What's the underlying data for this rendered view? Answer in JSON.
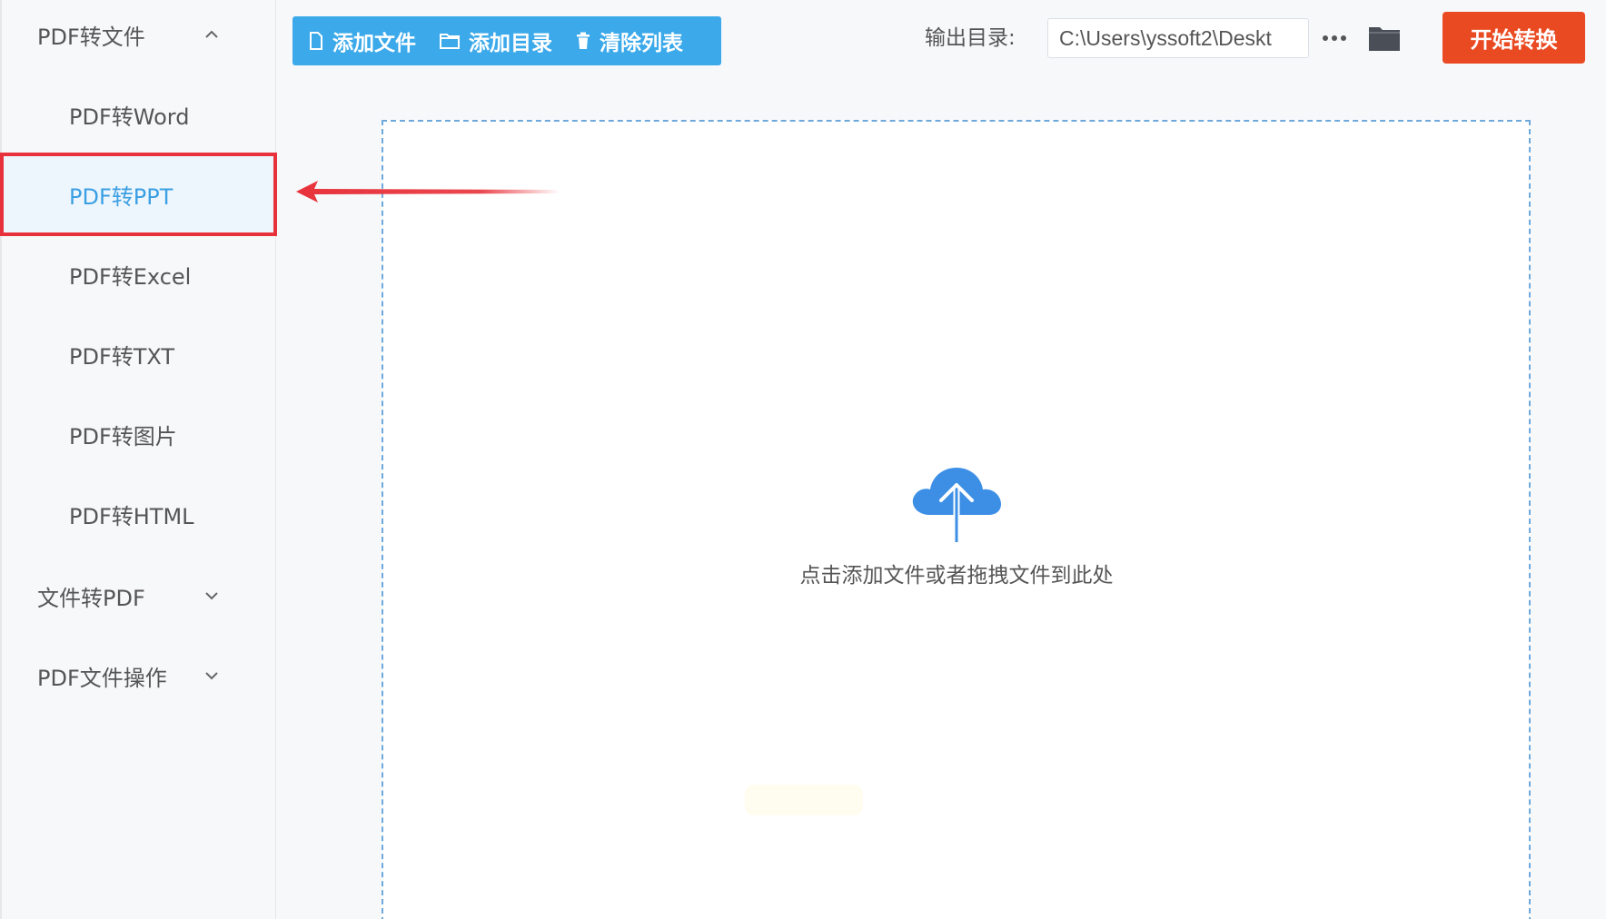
{
  "sidebar": {
    "groups": [
      {
        "label": "PDF转文件",
        "expanded": true,
        "items": [
          {
            "label": "PDF转Word"
          },
          {
            "label": "PDF转PPT",
            "active": true
          },
          {
            "label": "PDF转Excel"
          },
          {
            "label": "PDF转TXT"
          },
          {
            "label": "PDF转图片"
          },
          {
            "label": "PDF转HTML"
          }
        ]
      },
      {
        "label": "文件转PDF",
        "expanded": false
      },
      {
        "label": "PDF文件操作",
        "expanded": false
      }
    ]
  },
  "toolbar": {
    "add_file_label": "添加文件",
    "add_dir_label": "添加目录",
    "clear_list_label": "清除列表",
    "output_label": "输出目录:",
    "output_path": "C:\\Users\\yssoft2\\Deskt",
    "more_label": "···",
    "start_label": "开始转换"
  },
  "dropzone": {
    "hint": "点击添加文件或者拖拽文件到此处"
  },
  "colors": {
    "accent": "#3ba9ea",
    "start": "#ea4a22",
    "active_text": "#3b9fe3",
    "highlight_box": "#e8323b"
  },
  "icons": {
    "add_file": "file-icon",
    "add_dir": "folder-outline-icon",
    "clear_list": "trash-icon",
    "browse": "folder-icon",
    "upload": "cloud-upload-icon",
    "annotation": "red-arrow-icon"
  }
}
